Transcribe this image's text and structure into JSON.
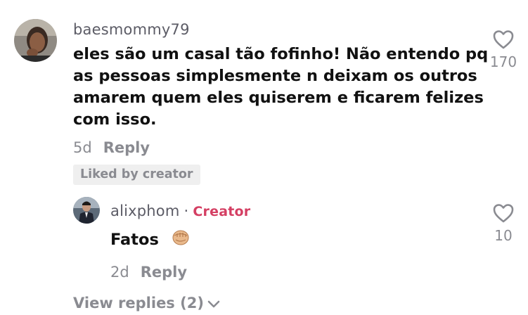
{
  "comment": {
    "username": "baesmommy79",
    "text_lines": [
      "eles são um casal tão fofinho! Não entendo pq",
      "as pessoas simplesmente n deixam os outros",
      "amarem quem eles quiserem e ficarem felizes",
      "com isso."
    ],
    "age": "5d",
    "reply_label": "Reply",
    "liked_badge": "Liked by creator",
    "like_count": "170"
  },
  "reply": {
    "username": "alixphom",
    "separator": "·",
    "creator_label": "Creator",
    "text": "Fatos",
    "age": "2d",
    "reply_label": "Reply",
    "like_count": "10"
  },
  "view_replies": {
    "label": "View replies (2)"
  },
  "colors": {
    "creator_accent": "#d43f63",
    "muted_text": "#8a8b91",
    "badge_bg": "#efefef"
  },
  "icons": {
    "like": "heart-outline-icon",
    "expand": "chevron-down-icon",
    "emoji": "raised-fist-emoji"
  }
}
